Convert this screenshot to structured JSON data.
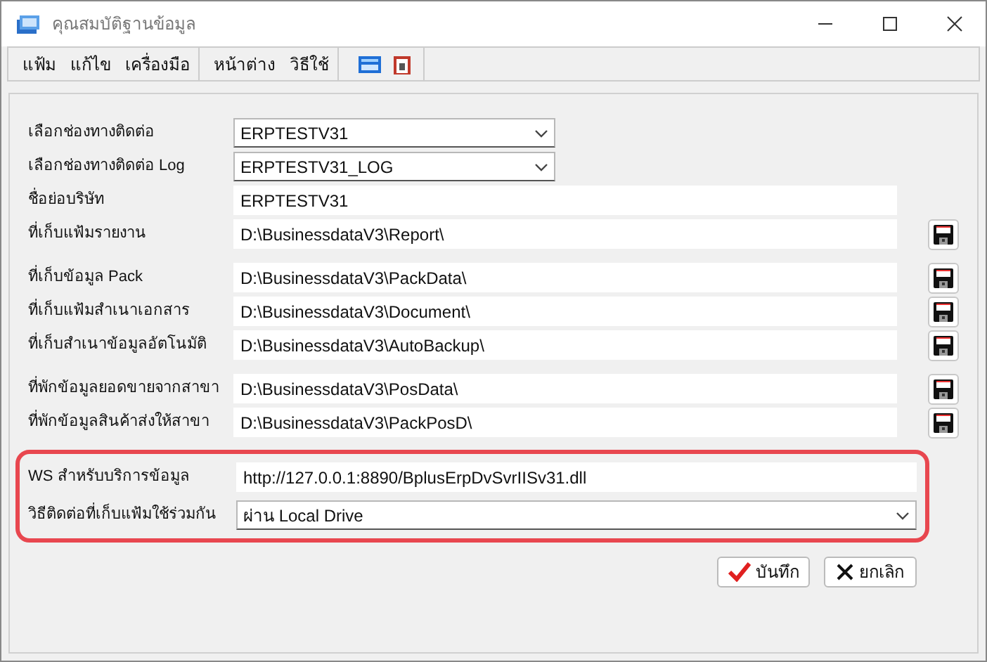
{
  "window": {
    "title": "คุณสมบัติฐานข้อมูล"
  },
  "menu": {
    "groups": [
      [
        "แฟ้ม",
        "แก้ไข",
        "เครื่องมือ"
      ],
      [
        "หน้าต่าง",
        "วิธีใช้"
      ]
    ]
  },
  "field_groups": [
    [
      {
        "label": "เลือกช่องทางติดต่อ",
        "kind": "select",
        "value": "ERPTESTV31",
        "save_button": false
      },
      {
        "label": "เลือกช่องทางติดต่อ Log",
        "kind": "select",
        "value": "ERPTESTV31_LOG",
        "save_button": false
      },
      {
        "label": "ชื่อย่อบริษัท",
        "kind": "text",
        "value": "ERPTESTV31",
        "save_button": false
      },
      {
        "label": "ที่เก็บแฟ้มรายงาน",
        "kind": "text",
        "value": "D:\\BusinessdataV3\\Report\\",
        "save_button": true
      }
    ],
    [
      {
        "label": "ที่เก็บข้อมูล Pack",
        "kind": "text",
        "value": "D:\\BusinessdataV3\\PackData\\",
        "save_button": true
      },
      {
        "label": "ที่เก็บแฟ้มสำเนาเอกสาร",
        "kind": "text",
        "value": "D:\\BusinessdataV3\\Document\\",
        "save_button": true
      },
      {
        "label": "ที่เก็บสำเนาข้อมูลอัตโนมัติ",
        "kind": "text",
        "value": "D:\\BusinessdataV3\\AutoBackup\\",
        "save_button": true
      }
    ],
    [
      {
        "label": "ที่พักข้อมูลยอดขายจากสาขา",
        "kind": "text",
        "value": "D:\\BusinessdataV3\\PosData\\",
        "save_button": true
      },
      {
        "label": "ที่พักข้อมูลสินค้าส่งให้สาขา",
        "kind": "text",
        "value": "D:\\BusinessdataV3\\PackPosD\\",
        "save_button": true
      }
    ]
  ],
  "highlighted_fields": [
    {
      "label": "WS สำหรับบริการข้อมูล",
      "kind": "text",
      "value": "http://127.0.0.1:8890/BplusErpDvSvrIISv31.dll"
    },
    {
      "label": "วิธีติดต่อที่เก็บแฟ้มใช้ร่วมกัน",
      "kind": "select",
      "value": "ผ่าน Local Drive"
    }
  ],
  "buttons": {
    "save": "บันทึก",
    "cancel": "ยกเลิก"
  }
}
